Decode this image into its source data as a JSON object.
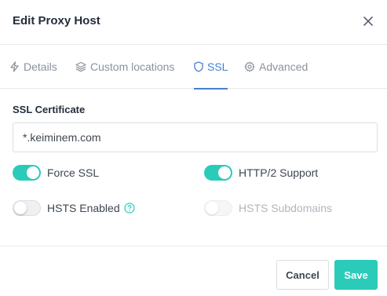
{
  "modal": {
    "title": "Edit Proxy Host"
  },
  "tabs": [
    {
      "label": "Details",
      "icon": "lightning-icon",
      "active": false
    },
    {
      "label": "Custom locations",
      "icon": "layers-icon",
      "active": false
    },
    {
      "label": "SSL",
      "icon": "shield-icon",
      "active": true
    },
    {
      "label": "Advanced",
      "icon": "gear-icon",
      "active": false
    }
  ],
  "ssl": {
    "certificate_label": "SSL Certificate",
    "certificate_value": "*.keiminem.com",
    "toggles": {
      "force_ssl": {
        "label": "Force SSL",
        "checked": true
      },
      "http2": {
        "label": "HTTP/2 Support",
        "checked": true
      },
      "hsts": {
        "label": "HSTS Enabled",
        "checked": false
      },
      "hsts_subdomains": {
        "label": "HSTS Subdomains",
        "checked": false,
        "disabled": true
      }
    }
  },
  "footer": {
    "cancel_label": "Cancel",
    "save_label": "Save"
  },
  "colors": {
    "accent": "#2bcbba",
    "active_tab": "#467fcf"
  }
}
